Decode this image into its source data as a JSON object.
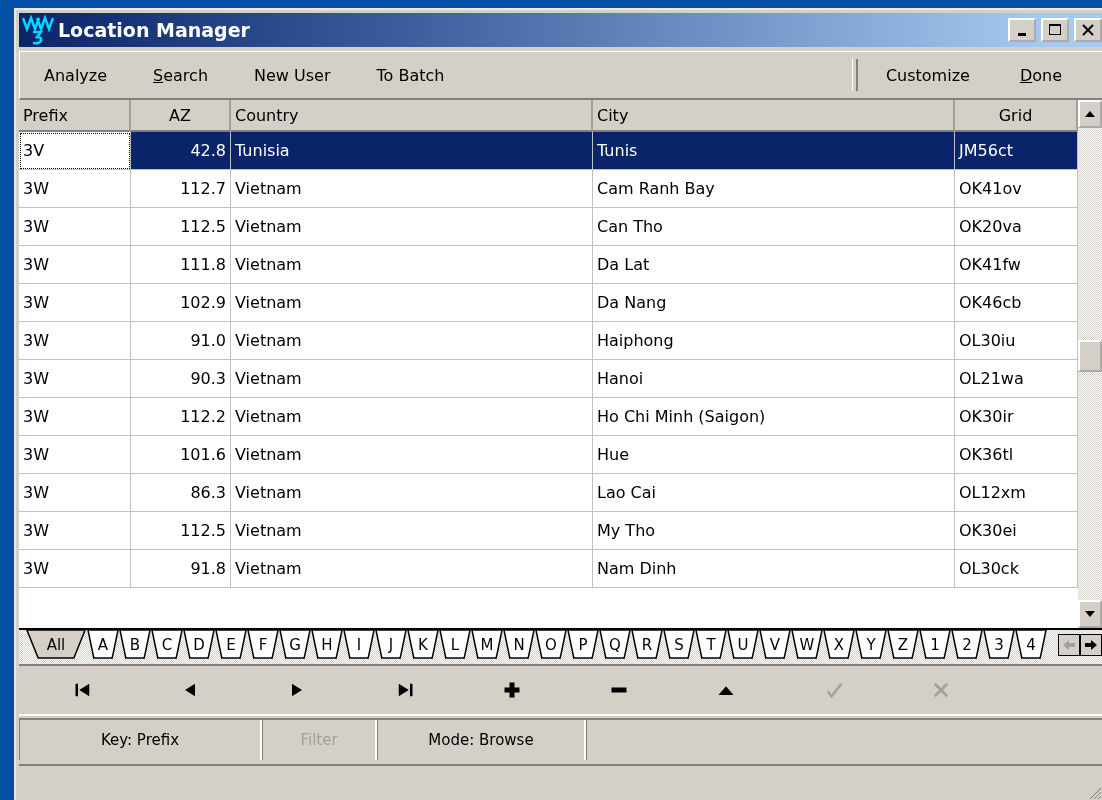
{
  "window": {
    "title": "Location Manager"
  },
  "toolbar": {
    "left": [
      {
        "label": "Analyze"
      },
      {
        "label": "Search",
        "first_letter_underlined": true
      },
      {
        "label": "New User"
      },
      {
        "label": "To Batch"
      }
    ],
    "right": [
      {
        "label": "Customize"
      },
      {
        "label": "Done",
        "first_letter_underlined": true
      }
    ]
  },
  "table": {
    "columns": [
      "Prefix",
      "AZ",
      "Country",
      "City",
      "Grid"
    ],
    "rows": [
      {
        "selected": true,
        "cells": [
          "3V",
          "42.8",
          "Tunisia",
          "Tunis",
          "JM56ct"
        ]
      },
      {
        "selected": false,
        "cells": [
          "3W",
          "112.7",
          "Vietnam",
          "Cam Ranh Bay",
          "OK41ov"
        ]
      },
      {
        "selected": false,
        "cells": [
          "3W",
          "112.5",
          "Vietnam",
          "Can Tho",
          "OK20va"
        ]
      },
      {
        "selected": false,
        "cells": [
          "3W",
          "111.8",
          "Vietnam",
          "Da Lat",
          "OK41fw"
        ]
      },
      {
        "selected": false,
        "cells": [
          "3W",
          "102.9",
          "Vietnam",
          "Da Nang",
          "OK46cb"
        ]
      },
      {
        "selected": false,
        "cells": [
          "3W",
          "91.0",
          "Vietnam",
          "Haiphong",
          "OL30iu"
        ]
      },
      {
        "selected": false,
        "cells": [
          "3W",
          "90.3",
          "Vietnam",
          "Hanoi",
          "OL21wa"
        ]
      },
      {
        "selected": false,
        "cells": [
          "3W",
          "112.2",
          "Vietnam",
          "Ho Chi Minh (Saigon)",
          "OK30ir"
        ]
      },
      {
        "selected": false,
        "cells": [
          "3W",
          "101.6",
          "Vietnam",
          "Hue",
          "OK36tl"
        ]
      },
      {
        "selected": false,
        "cells": [
          "3W",
          "86.3",
          "Vietnam",
          "Lao Cai",
          "OL12xm"
        ]
      },
      {
        "selected": false,
        "cells": [
          "3W",
          "112.5",
          "Vietnam",
          "My Tho",
          "OK30ei"
        ]
      },
      {
        "selected": false,
        "cells": [
          "3W",
          "91.8",
          "Vietnam",
          "Nam Dinh",
          "OL30ck"
        ]
      }
    ]
  },
  "index_tabs": [
    {
      "label": "All",
      "selected": true
    },
    {
      "label": "A",
      "selected": false
    },
    {
      "label": "B",
      "selected": false
    },
    {
      "label": "C",
      "selected": false
    },
    {
      "label": "D",
      "selected": false
    },
    {
      "label": "E",
      "selected": false
    },
    {
      "label": "F",
      "selected": false
    },
    {
      "label": "G",
      "selected": false
    },
    {
      "label": "H",
      "selected": false
    },
    {
      "label": "I",
      "selected": false
    },
    {
      "label": "J",
      "selected": false
    },
    {
      "label": "K",
      "selected": false
    },
    {
      "label": "L",
      "selected": false
    },
    {
      "label": "M",
      "selected": false
    },
    {
      "label": "N",
      "selected": false
    },
    {
      "label": "O",
      "selected": false
    },
    {
      "label": "P",
      "selected": false
    },
    {
      "label": "Q",
      "selected": false
    },
    {
      "label": "R",
      "selected": false
    },
    {
      "label": "S",
      "selected": false
    },
    {
      "label": "T",
      "selected": false
    },
    {
      "label": "U",
      "selected": false
    },
    {
      "label": "V",
      "selected": false
    },
    {
      "label": "W",
      "selected": false
    },
    {
      "label": "X",
      "selected": false
    },
    {
      "label": "Y",
      "selected": false
    },
    {
      "label": "Z",
      "selected": false
    },
    {
      "label": "1",
      "selected": false
    },
    {
      "label": "2",
      "selected": false
    },
    {
      "label": "3",
      "selected": false
    },
    {
      "label": "4",
      "selected": false
    }
  ],
  "navigator": [
    {
      "kind": "first",
      "disabled": false
    },
    {
      "kind": "prior",
      "disabled": false
    },
    {
      "kind": "next",
      "disabled": false
    },
    {
      "kind": "last",
      "disabled": false
    },
    {
      "kind": "insert",
      "disabled": false
    },
    {
      "kind": "delete",
      "disabled": false
    },
    {
      "kind": "edit",
      "disabled": false
    },
    {
      "kind": "post",
      "disabled": true
    },
    {
      "kind": "cancel",
      "disabled": true
    }
  ],
  "status_bar": [
    {
      "text": "Key: Prefix",
      "disabled": false
    },
    {
      "text": "Filter",
      "disabled": true
    },
    {
      "text": "Mode: Browse",
      "disabled": false
    }
  ]
}
